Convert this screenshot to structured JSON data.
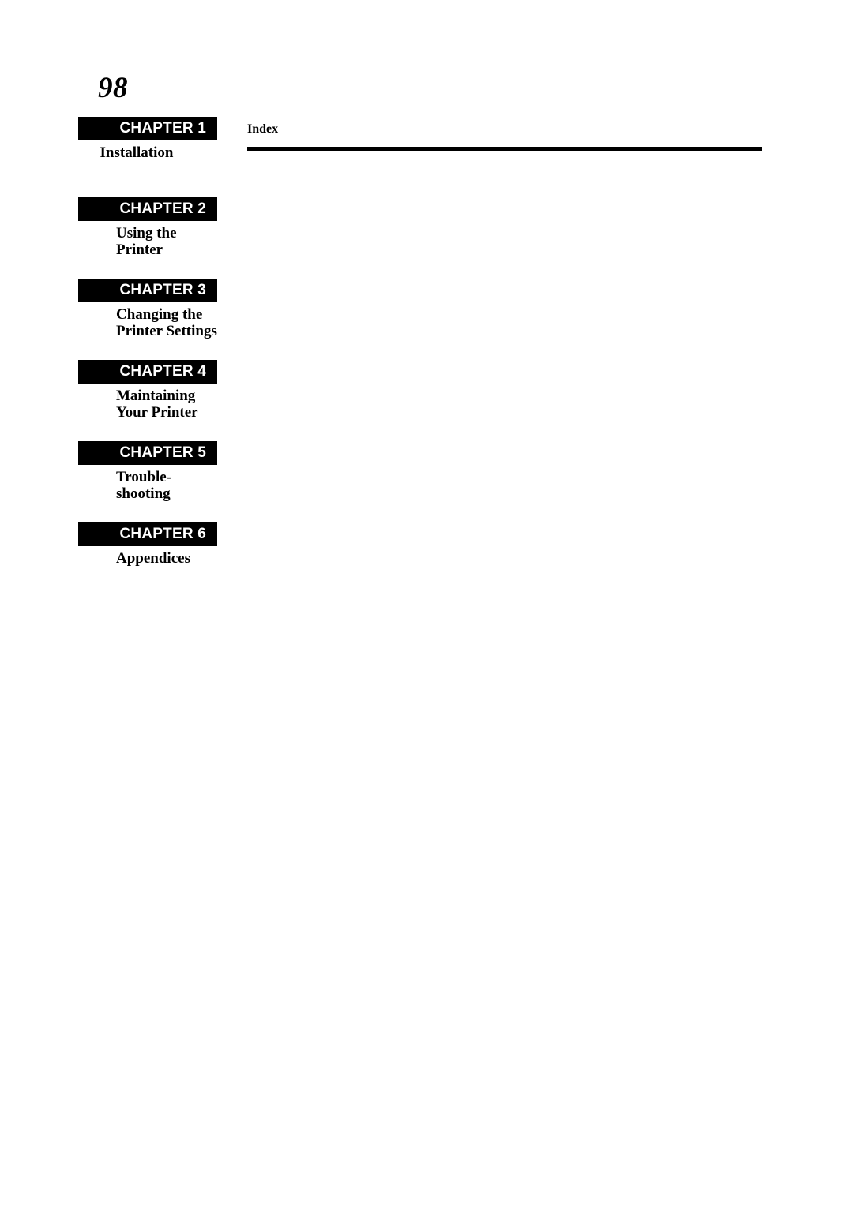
{
  "page": {
    "page_number": "98",
    "background_color": "#ffffff",
    "text_color": "#000000"
  },
  "chapter_rail": {
    "bar_background": "#000000",
    "bar_text_color": "#ffffff",
    "items": [
      {
        "bar_label": "CHAPTER 1",
        "title": "Installation",
        "align": "centered"
      },
      {
        "bar_label": "CHAPTER 2",
        "title": "Using the\nPrinter",
        "align": "left"
      },
      {
        "bar_label": "CHAPTER 3",
        "title": "Changing the\nPrinter Settings",
        "align": "left"
      },
      {
        "bar_label": "CHAPTER 4",
        "title": "Maintaining\nYour Printer",
        "align": "left"
      },
      {
        "bar_label": "CHAPTER 5",
        "title": "Trouble-\nshooting",
        "align": "left"
      },
      {
        "bar_label": "CHAPTER 6",
        "title": "Appendices",
        "align": "left"
      }
    ]
  },
  "index_section": {
    "heading": "Index",
    "rule_color": "#000000",
    "body": ""
  }
}
